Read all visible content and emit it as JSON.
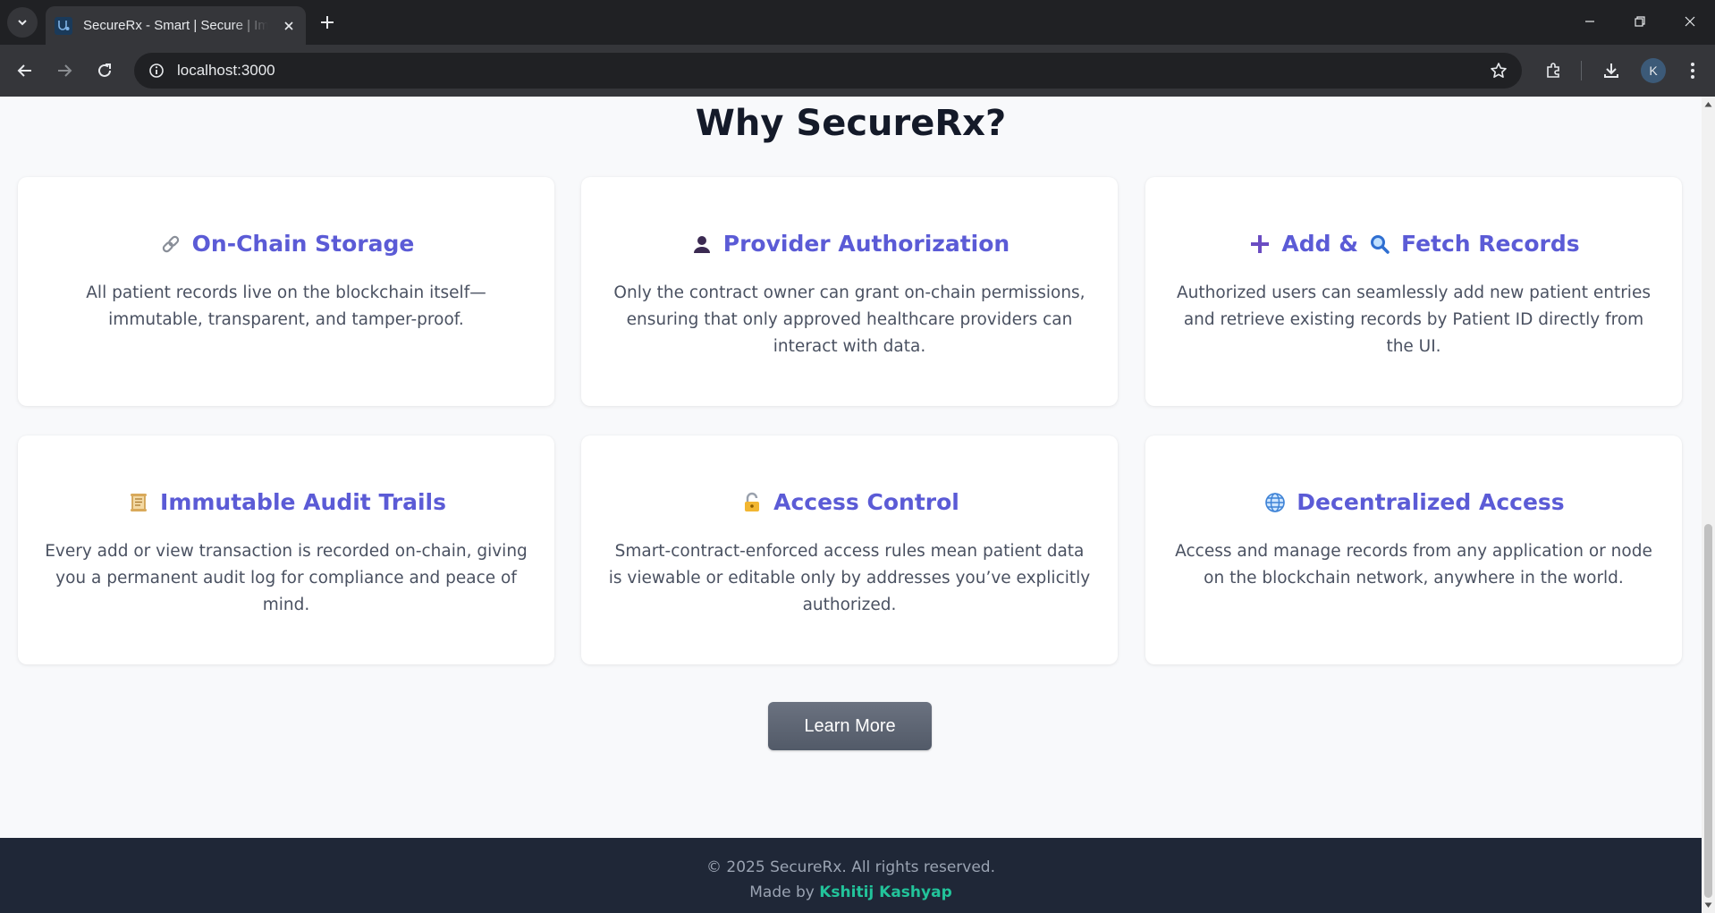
{
  "browser": {
    "tab_title": "SecureRx - Smart | Secure | Immutable",
    "url": "localhost:3000",
    "profile_initial": "K"
  },
  "page": {
    "heading": "Why SecureRx?",
    "cards": [
      {
        "icon": "link-icon",
        "title": "On-Chain Storage",
        "desc": "All patient records live on the blockchain itself—immutable, transparent, and tamper-proof."
      },
      {
        "icon": "bust-icon",
        "title": "Provider Authorization",
        "desc": "Only the contract owner can grant on-chain permissions, ensuring that only approved healthcare providers can interact with data."
      },
      {
        "icon": "plus-icon",
        "icon2": "magnifier-icon",
        "title_part1": "Add &",
        "title_part2": "Fetch Records",
        "desc": "Authorized users can seamlessly add new patient entries and retrieve existing records by Patient ID directly from the UI."
      },
      {
        "icon": "scroll-icon",
        "title": "Immutable Audit Trails",
        "desc": "Every add or view transaction is recorded on-chain, giving you a permanent audit log for compliance and peace of mind."
      },
      {
        "icon": "lock-icon",
        "title": "Access Control",
        "desc": "Smart-contract-enforced access rules mean patient data is viewable or editable only by addresses you’ve explicitly authorized."
      },
      {
        "icon": "globe-icon",
        "title": "Decentralized Access",
        "desc": "Access and manage records from any application or node on the blockchain network, anywhere in the world."
      }
    ],
    "learn_more_label": "Learn More"
  },
  "footer": {
    "copyright": "© 2025 SecureRx. All rights reserved.",
    "made_by_prefix": "Made by",
    "author": "Kshitij Kashyap"
  },
  "colors": {
    "accent": "#5b5bd6",
    "heading": "#141a29",
    "footer_bg": "#1f2737",
    "author_link": "#22c39a"
  }
}
